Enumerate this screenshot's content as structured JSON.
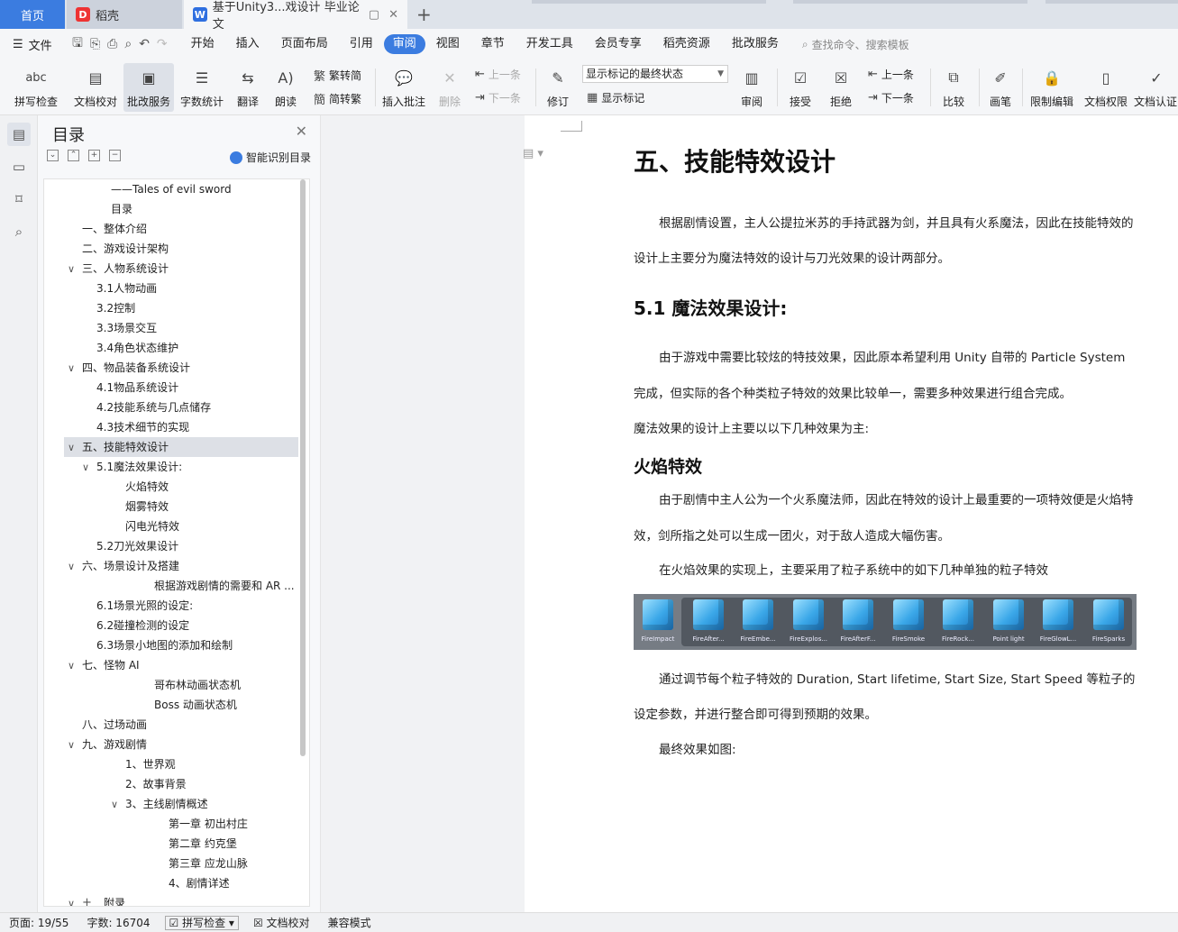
{
  "tabs": {
    "home": "首页",
    "tab1": "稻壳",
    "tab2": "基于Unity3...戏设计 毕业论文",
    "new_tab": "+"
  },
  "menubar": {
    "file": "文件",
    "menus": [
      "开始",
      "插入",
      "页面布局",
      "引用",
      "审阅",
      "视图",
      "章节",
      "开发工具",
      "会员专享",
      "稻壳资源",
      "批改服务"
    ],
    "active": "审阅",
    "search": "查找命令、搜索模板"
  },
  "ribbon": {
    "spell": "拼写检查",
    "proof": "文档校对",
    "correct_service": "批改服务",
    "word_count": "字数统计",
    "translate": "翻译",
    "read_aloud": "朗读",
    "trad": "繁转简",
    "simp": "简转繁",
    "insert_comment": "插入批注",
    "delete": "删除",
    "prev": "上一条",
    "next": "下一条",
    "track": "修订",
    "markup_select": "显示标记的最终状态",
    "show_markup": "显示标记",
    "review": "审阅",
    "accept": "接受",
    "reject": "拒绝",
    "prev2": "上一条",
    "next2": "下一条",
    "compare": "比较",
    "pen": "画笔",
    "restrict": "限制编辑",
    "doc_perm": "文档权限",
    "doc_cert": "文档认证"
  },
  "toc": {
    "title": "目录",
    "smart": "智能识别目录",
    "items": [
      {
        "text": "——Tales of evil sword"
      },
      {
        "text": "目录"
      },
      {
        "text": "一、整体介绍"
      },
      {
        "text": "二、游戏设计架构"
      },
      {
        "text": "三、人物系统设计"
      },
      {
        "text": "3.1人物动画"
      },
      {
        "text": "3.2控制"
      },
      {
        "text": "3.3场景交互"
      },
      {
        "text": "3.4角色状态维护"
      },
      {
        "text": "四、物品装备系统设计"
      },
      {
        "text": "4.1物品系统设计"
      },
      {
        "text": "4.2技能系统与几点储存"
      },
      {
        "text": "4.3技术细节的实现"
      },
      {
        "text": "五、技能特效设计"
      },
      {
        "text": "5.1魔法效果设计:"
      },
      {
        "text": "火焰特效"
      },
      {
        "text": "烟雾特效"
      },
      {
        "text": "闪电光特效"
      },
      {
        "text": "5.2刀光效果设计"
      },
      {
        "text": "六、场景设计及搭建"
      },
      {
        "text": "根据游戏剧情的需要和 AR ..."
      },
      {
        "text": "6.1场景光照的设定:"
      },
      {
        "text": "6.2碰撞检测的设定"
      },
      {
        "text": "6.3场景小地图的添加和绘制"
      },
      {
        "text": "七、怪物 AI"
      },
      {
        "text": "哥布林动画状态机"
      },
      {
        "text": "Boss 动画状态机"
      },
      {
        "text": "八、过场动画"
      },
      {
        "text": "九、游戏剧情"
      },
      {
        "text": "1、世界观"
      },
      {
        "text": "2、故事背景"
      },
      {
        "text": "3、主线剧情概述"
      },
      {
        "text": "第一章 初出村庄"
      },
      {
        "text": "第二章 约克堡"
      },
      {
        "text": "第三章 应龙山脉"
      },
      {
        "text": "4、剧情详述"
      },
      {
        "text": "附录"
      }
    ]
  },
  "doc": {
    "h1": "五、技能特效设计",
    "p1a": "根据剧情设置，主人公提拉米苏的手持武器为剑，并且具有火系魔法，因此在技能特效的",
    "p1b": "设计上主要分为魔法特效的设计与刀光效果的设计两部分。",
    "h2": "5.1 魔法效果设计:",
    "p2a": "由于游戏中需要比较炫的特技效果，因此原本希望利用 Unity 自带的 Particle System",
    "p2b": "完成，但实际的各个种类粒子特效的效果比较单一，需要多种效果进行组合完成。",
    "p3": "魔法效果的设计上主要以以下几种效果为主:",
    "h3": "火焰特效",
    "p4a": "由于剧情中主人公为一个火系魔法师，因此在特效的设计上最重要的一项特效便是火焰特",
    "p4b": "效，剑所指之处可以生成一团火，对于敌人造成大幅伤害。",
    "p5": "在火焰效果的实现上，主要采用了粒子系统中的如下几种单独的粒子特效",
    "particles": [
      "FireImpact",
      "FireAfter...",
      "FireEmbe...",
      "FireExplos...",
      "FireAfterF...",
      "FireSmoke",
      "FireRock...",
      "Point light",
      "FireGlowL...",
      "FireSparks"
    ],
    "p6a": "通过调节每个粒子特效的 Duration, Start lifetime, Start Size, Start Speed 等粒子的",
    "p6b": "设定参数，并进行整合即可得到预期的效果。",
    "p7": "最终效果如图:"
  },
  "status": {
    "page": "页面: 19/55",
    "words": "字数: 16704",
    "spell": "拼写检查",
    "proof": "文档校对",
    "compat": "兼容模式"
  }
}
